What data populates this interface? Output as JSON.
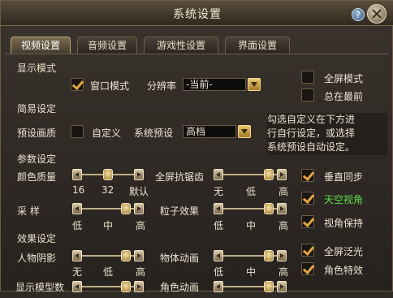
{
  "window": {
    "title": "系统设置"
  },
  "tabs": [
    "视频设置",
    "音频设置",
    "游戏性设置",
    "界面设置"
  ],
  "display_mode": {
    "section": "显示模式",
    "windowed_label": "窗口模式",
    "windowed_checked": true,
    "resolution_label": "分辨率",
    "resolution_value": "-当前-",
    "fullscreen_label": "全屏模式",
    "fullscreen_checked": false,
    "topmost_label": "总在最前",
    "topmost_checked": false
  },
  "simple": {
    "section": "简易设定",
    "preset_quality_label": "预设画质",
    "custom_label": "自定义",
    "custom_checked": false,
    "system_preset_label": "系统预设",
    "system_preset_value": "高档",
    "info_text_1": "勾选自定义在下方进",
    "info_text_2": "行自行设定，或选择",
    "info_text_3": "系统预设自动设定。"
  },
  "params": {
    "section": "参数设定",
    "color_quality": {
      "label": "颜色质量",
      "ticks": [
        "16",
        "32",
        "默认"
      ],
      "level": 0.5
    },
    "fsaa": {
      "label": "全屏抗锯齿",
      "ticks": [
        "无",
        "低",
        "高"
      ],
      "level": 1.0
    },
    "vsync": {
      "label": "垂直同步",
      "checked": true
    },
    "sampling": {
      "label": "采  样",
      "ticks": [
        "低",
        "中",
        "高"
      ],
      "level": 1.0
    },
    "particles": {
      "label": "粒子效果",
      "ticks": [
        "低",
        "中",
        "高"
      ],
      "level": 1.0
    },
    "sky_view": {
      "label": "天空视角",
      "checked": true
    },
    "view_hold": {
      "label": "视角保持",
      "checked": true
    }
  },
  "effects": {
    "section": "效果设定",
    "char_shadow": {
      "label": "人物阴影",
      "ticks": [
        "无",
        "低",
        "高"
      ],
      "level": 1.0
    },
    "object_anim": {
      "label": "物体动画",
      "ticks": [
        "低",
        "中",
        "高"
      ],
      "level": 1.0
    },
    "fullscreen_glow": {
      "label": "全屏泛光",
      "checked": true
    },
    "char_effects": {
      "label": "角色特效",
      "checked": true
    },
    "model_count": {
      "label": "显示模型数"
    },
    "char_anim": {
      "label": "角色动画"
    }
  },
  "colors": {
    "accent": "#e6a43a",
    "highlight": "#5ce04a"
  }
}
